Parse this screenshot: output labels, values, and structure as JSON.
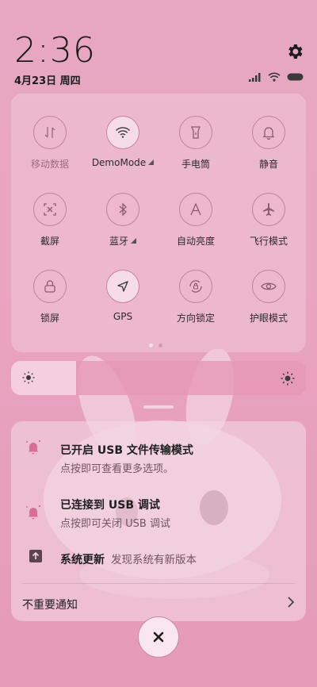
{
  "status": {
    "time": "2:36",
    "date": "4月23日 周四"
  },
  "icons": {
    "settings": "gear-icon",
    "signal": "signal-icon",
    "wifi": "wifi-icon",
    "battery": "battery-icon"
  },
  "tiles": [
    {
      "label": "移动数据",
      "icon": "mobile-data-icon",
      "active": false
    },
    {
      "label": "DemoMode",
      "icon": "wifi-icon",
      "active": true,
      "arrow": true
    },
    {
      "label": "手电筒",
      "icon": "flashlight-icon",
      "active": false
    },
    {
      "label": "静音",
      "icon": "bell-icon",
      "active": false
    },
    {
      "label": "截屏",
      "icon": "screenshot-icon",
      "active": false
    },
    {
      "label": "蓝牙",
      "icon": "bluetooth-icon",
      "active": false,
      "arrow": true
    },
    {
      "label": "自动亮度",
      "icon": "auto-brightness-icon",
      "active": false
    },
    {
      "label": "飞行模式",
      "icon": "airplane-icon",
      "active": false
    },
    {
      "label": "锁屏",
      "icon": "lock-icon",
      "active": false
    },
    {
      "label": "GPS",
      "icon": "location-arrow-icon",
      "active": true
    },
    {
      "label": "方向锁定",
      "icon": "rotation-lock-icon",
      "active": false
    },
    {
      "label": "护眼模式",
      "icon": "eye-icon",
      "active": false
    }
  ],
  "brightness": {
    "level": 0.22
  },
  "notifications": [
    {
      "title": "已开启 USB 文件传输模式",
      "subtitle": "点按即可查看更多选项。",
      "icon": "usb-bell-icon"
    },
    {
      "title": "已连接到 USB 调试",
      "subtitle": "点按即可关闭 USB 调试",
      "icon": "usb-bell-icon"
    }
  ],
  "system_update": {
    "title": "系统更新",
    "subtitle": "发现系统有新版本",
    "icon": "upload-icon"
  },
  "unimportant": {
    "label": "不重要通知"
  },
  "colors": {
    "background": "#e7a6c1",
    "accent": "#c8839f"
  }
}
